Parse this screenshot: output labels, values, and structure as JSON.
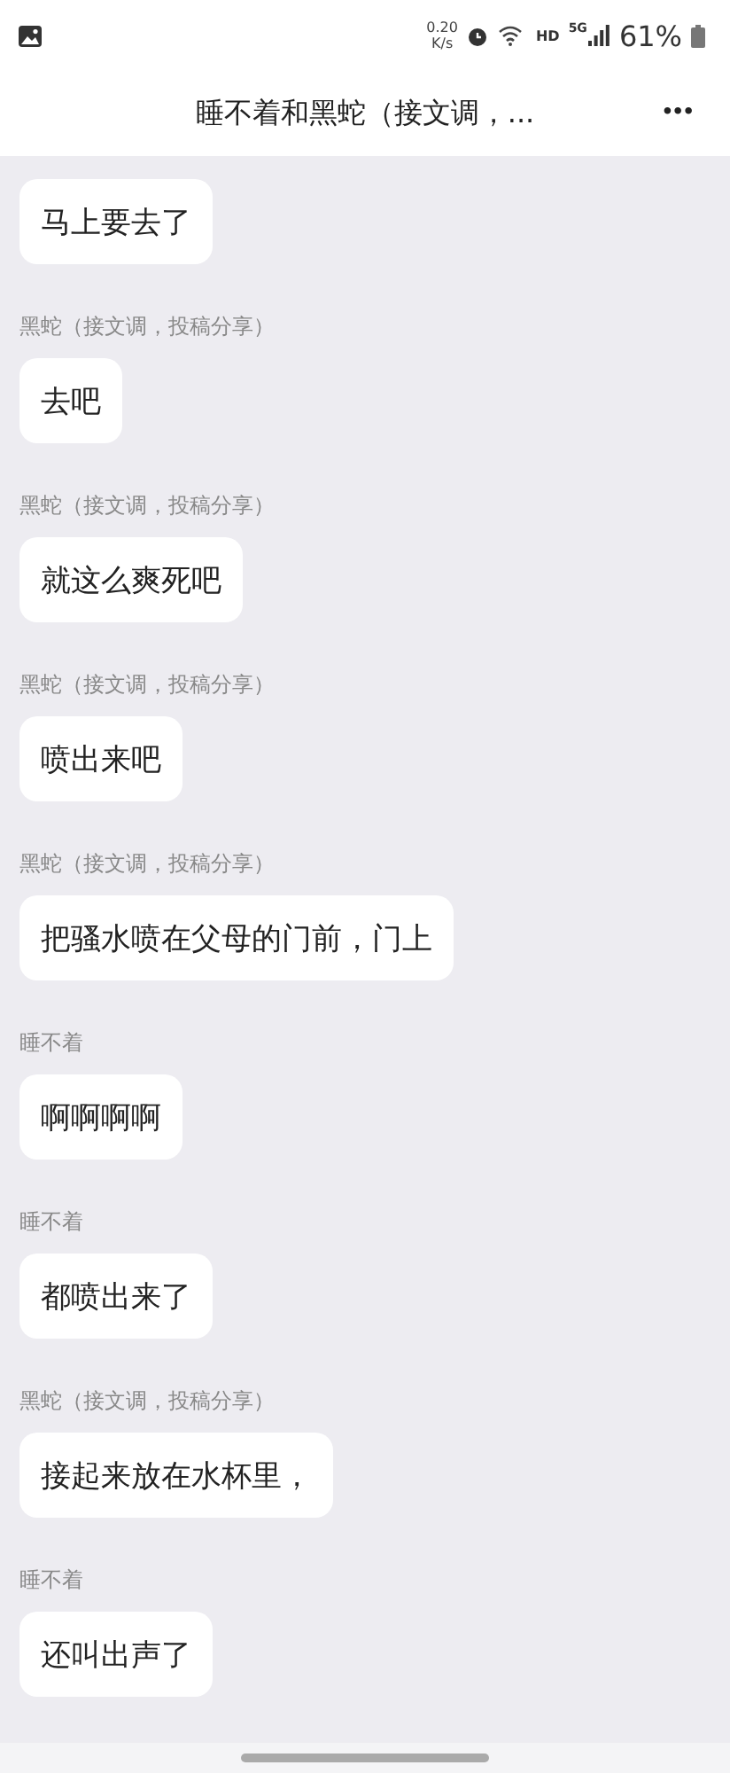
{
  "status_bar": {
    "speed": "0.20",
    "speed_unit": "K/s",
    "network_label": "HD",
    "signal_label": "5G",
    "battery": "61%"
  },
  "header": {
    "title": "睡不着和黑蛇（接文调，...",
    "more": "•••"
  },
  "messages": [
    {
      "text": "马上要去了"
    },
    {
      "sender": "黑蛇（接文调，投稿分享）",
      "text": "去吧"
    },
    {
      "sender": "黑蛇（接文调，投稿分享）",
      "text": "就这么爽死吧"
    },
    {
      "sender": "黑蛇（接文调，投稿分享）",
      "text": "喷出来吧"
    },
    {
      "sender": "黑蛇（接文调，投稿分享）",
      "text": "把骚水喷在父母的门前，门上"
    },
    {
      "sender": "睡不着",
      "text": "啊啊啊啊"
    },
    {
      "sender": "睡不着",
      "text": "都喷出来了"
    },
    {
      "sender": "黑蛇（接文调，投稿分享）",
      "text": "接起来放在水杯里，"
    },
    {
      "sender": "睡不着",
      "text": "还叫出声了"
    }
  ]
}
